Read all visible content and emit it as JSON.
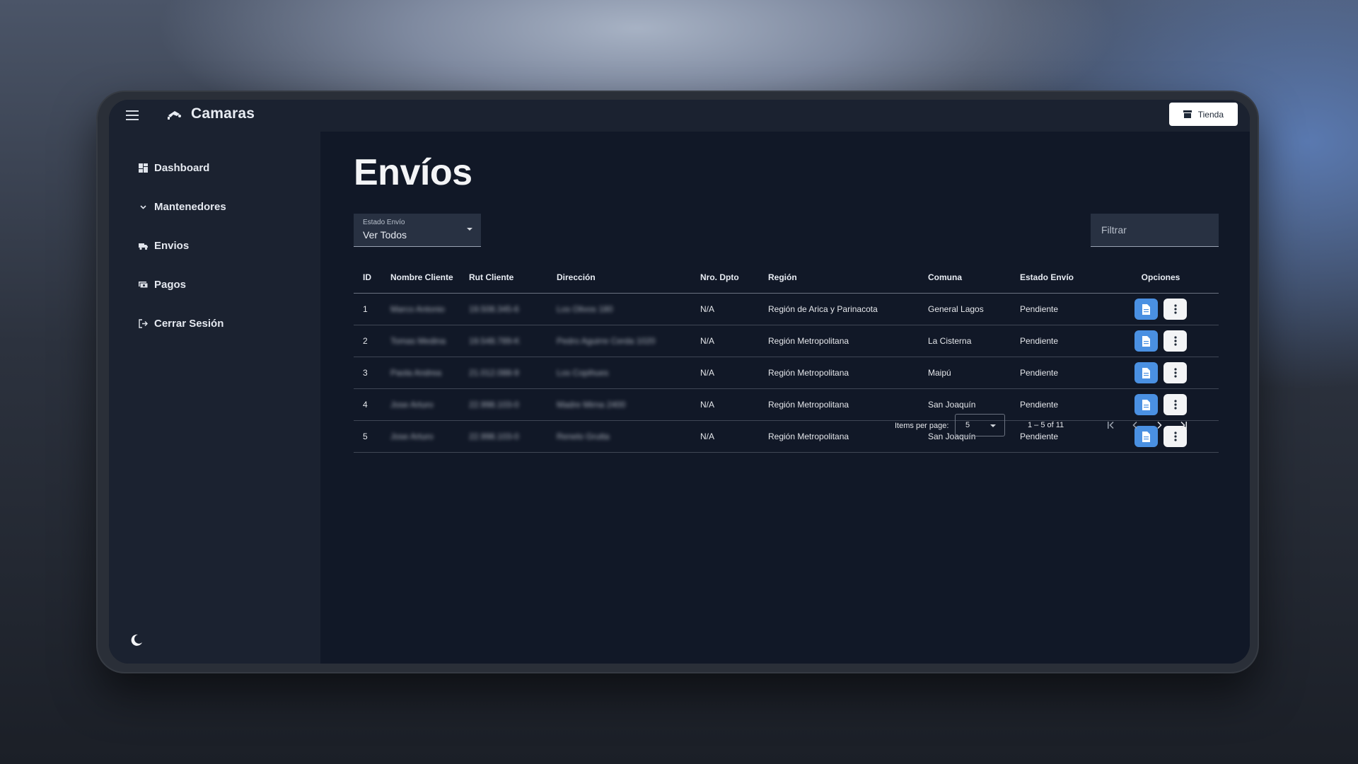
{
  "app": {
    "title": "Camaras",
    "store_button": "Tienda"
  },
  "sidebar": {
    "items": [
      {
        "label": "Dashboard",
        "icon": "dashboard-icon"
      },
      {
        "label": "Mantenedores",
        "icon": "chevron-down-icon"
      },
      {
        "label": "Envios",
        "icon": "truck-icon"
      },
      {
        "label": "Pagos",
        "icon": "payments-icon"
      },
      {
        "label": "Cerrar Sesión",
        "icon": "logout-icon"
      }
    ],
    "theme_toggle_icon": "moon-icon"
  },
  "main": {
    "title": "Envíos",
    "status_filter": {
      "label": "Estado Envío",
      "value": "Ver Todos"
    },
    "search": {
      "placeholder": "Filtrar"
    }
  },
  "table": {
    "headers": [
      "ID",
      "Nombre Cliente",
      "Rut Cliente",
      "Dirección",
      "Nro. Dpto",
      "Región",
      "Comuna",
      "Estado Envío",
      "Opciones"
    ],
    "rows": [
      {
        "id": "1",
        "nombre": "Marco Antonio",
        "rut": "19.508.345-6",
        "direccion": "Los Olivos 180",
        "dpto": "N/A",
        "region": "Región de Arica y Parinacota",
        "comuna": "General Lagos",
        "estado": "Pendiente"
      },
      {
        "id": "2",
        "nombre": "Tomas Medina",
        "rut": "19.548.789-K",
        "direccion": "Pedro Aguirre Cerda 1020",
        "dpto": "N/A",
        "region": "Región Metropolitana",
        "comuna": "La Cisterna",
        "estado": "Pendiente"
      },
      {
        "id": "3",
        "nombre": "Paola Andrea",
        "rut": "21.012.088-9",
        "direccion": "Los Copihues",
        "dpto": "N/A",
        "region": "Región Metropolitana",
        "comuna": "Maipú",
        "estado": "Pendiente"
      },
      {
        "id": "4",
        "nombre": "Jose Arturo",
        "rut": "22.998.103-0",
        "direccion": "Madre Mirna 2400",
        "dpto": "N/A",
        "region": "Región Metropolitana",
        "comuna": "San Joaquín",
        "estado": "Pendiente"
      },
      {
        "id": "5",
        "nombre": "Jose Arturo",
        "rut": "22.998.103-0",
        "direccion": "Renelo Grutta",
        "dpto": "N/A",
        "region": "Región Metropolitana",
        "comuna": "San Joaquín",
        "estado": "Pendiente"
      }
    ]
  },
  "pagination": {
    "items_per_page_label": "Items per page:",
    "items_per_page_value": "5",
    "range_label": "1 – 5 of 11"
  },
  "colors": {
    "accent": "#4a90e2",
    "surface": "#1b2230",
    "background": "#111827"
  }
}
